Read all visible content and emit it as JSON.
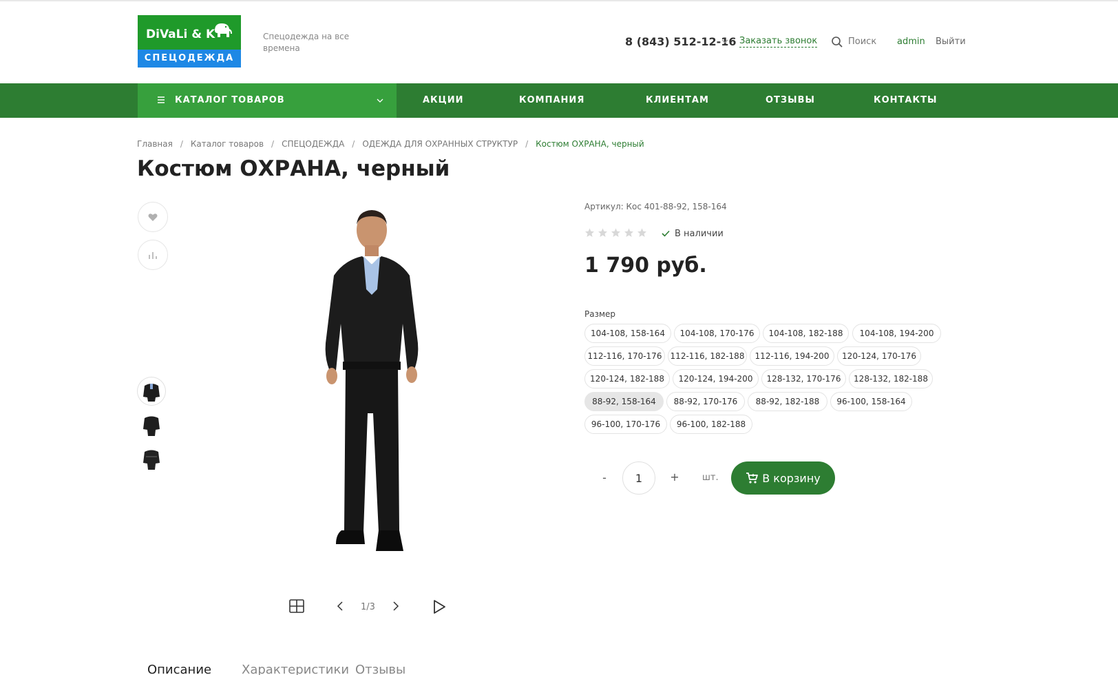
{
  "header": {
    "logo_name": "DiVaLi & K",
    "logo_sub": "СПЕЦОДЕЖДА",
    "slogan": "Спецодежда на все времена",
    "phone": "8 (843) 512-12-16",
    "callback_label": "Заказать звонок",
    "search_label": "Поиск",
    "user_label": "admin",
    "logout_label": "Выйти"
  },
  "nav": {
    "catalog_label": "КАТАЛОГ ТОВАРОВ",
    "items": [
      "АКЦИИ",
      "КОМПАНИЯ",
      "КЛИЕНТАМ",
      "ОТЗЫВЫ",
      "КОНТАКТЫ"
    ]
  },
  "breadcrumb": {
    "items": [
      "Главная",
      "Каталог товаров",
      "СПЕЦОДЕЖДА",
      "ОДЕЖДА ДЛЯ ОХРАННЫХ СТРУКТУР"
    ],
    "current": "Костюм ОХРАНА, черный",
    "separator": "/"
  },
  "product": {
    "title": "Костюм ОХРАНА, черный",
    "article": "Артикул: Кос 401-88-92, 158-164",
    "rating": 0,
    "rating_max": 5,
    "stock": "В наличии",
    "price": "1 790 руб.",
    "size_label": "Размер",
    "sizes": [
      "104-108, 158-164",
      "104-108, 170-176",
      "104-108, 182-188",
      "104-108, 194-200",
      "112-116, 170-176",
      "112-116, 182-188",
      "112-116, 194-200",
      "120-124, 170-176",
      "120-124, 182-188",
      "120-124, 194-200",
      "128-132, 170-176",
      "128-132, 182-188",
      "88-92, 158-164",
      "88-92, 170-176",
      "88-92, 182-188",
      "96-100, 158-164",
      "96-100, 170-176",
      "96-100, 182-188"
    ],
    "selected_size": "88-92, 158-164",
    "quantity": "1",
    "qty_minus": "-",
    "qty_plus": "+",
    "unit": "шт.",
    "cart_label": "В корзину"
  },
  "gallery": {
    "pager": "1/3",
    "current": 1,
    "total": 3
  },
  "tabs": [
    "Описание",
    "Характеристики",
    "Отзывы"
  ],
  "colors": {
    "brand_green": "#2d7d32",
    "catalog_green": "#37a03d",
    "logo_blue": "#1e88e5"
  }
}
